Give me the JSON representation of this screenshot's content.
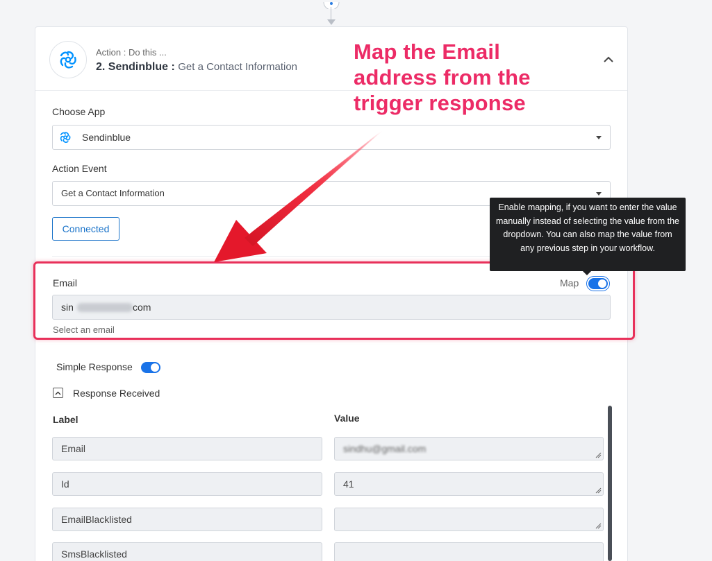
{
  "card": {
    "subtitle": "Action : Do this ...",
    "title": "2. Sendinblue :",
    "event": "Get a Contact Information"
  },
  "choose_app": {
    "label": "Choose App",
    "value": "Sendinblue"
  },
  "action_event": {
    "label": "Action Event",
    "value": "Get a Contact Information"
  },
  "connected_label": "Connected",
  "email_field": {
    "label": "Email",
    "map_label": "Map",
    "value_prefix": "sin",
    "value_suffix": "com",
    "help": "Select an email"
  },
  "tooltip": "Enable mapping, if you want to enter the value manually instead of selecting the value from the dropdown. You can also map the value from any previous step in your workflow.",
  "annotation": {
    "line1": "Map the Email",
    "line2": "address from the",
    "line3": "trigger response",
    "color": "#ec2b66"
  },
  "simple_response_label": "Simple Response",
  "response_received_label": "Response Received",
  "table": {
    "label_header": "Label",
    "value_header": "Value",
    "rows": [
      {
        "label": "Email",
        "value": "sindhu@gmail.com"
      },
      {
        "label": "Id",
        "value": "41"
      },
      {
        "label": "EmailBlacklisted",
        "value": ""
      },
      {
        "label": "SmsBlacklisted",
        "value": ""
      }
    ]
  },
  "colors": {
    "accent": "#1a73e8",
    "highlight": "#e8305a"
  }
}
